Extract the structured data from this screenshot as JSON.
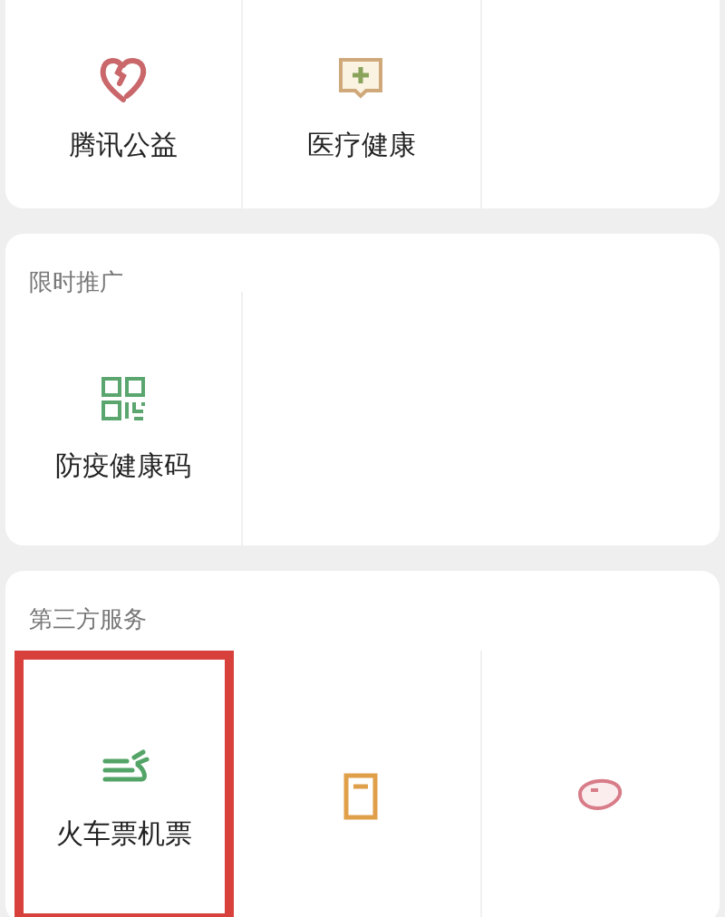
{
  "sections": [
    {
      "items": [
        {
          "label": "腾讯公益",
          "highlighted": false
        },
        {
          "label": "医疗健康",
          "highlighted": false
        }
      ]
    },
    {
      "title": "限时推广",
      "items": [
        {
          "label": "防疫健康码",
          "highlighted": false
        }
      ]
    },
    {
      "title": "第三方服务",
      "items": [
        {
          "label": "火车票机票",
          "highlighted": true
        },
        {
          "highlighted": false
        },
        {
          "highlighted": false
        }
      ]
    }
  ]
}
